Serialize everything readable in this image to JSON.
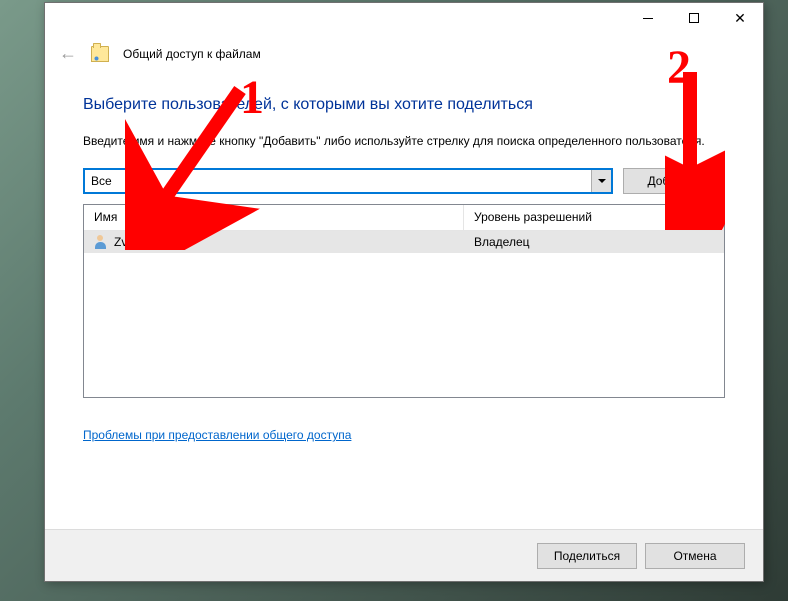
{
  "window": {
    "title": "Общий доступ к файлам"
  },
  "main": {
    "heading": "Выберите пользователей, с которыми вы хотите поделиться",
    "instructions": "Введите имя и нажмите кнопку \"Добавить\" либо используйте стрелку для поиска определенного пользователя.",
    "combo_value": "Все",
    "add_button": "Добавить"
  },
  "list": {
    "headers": {
      "name": "Имя",
      "permission": "Уровень разрешений"
    },
    "rows": [
      {
        "name": "Zver",
        "permission": "Владелец"
      }
    ]
  },
  "help_link": "Проблемы при предоставлении общего доступа",
  "footer": {
    "share": "Поделиться",
    "cancel": "Отмена"
  },
  "annotations": {
    "one": "1",
    "two": "2"
  }
}
